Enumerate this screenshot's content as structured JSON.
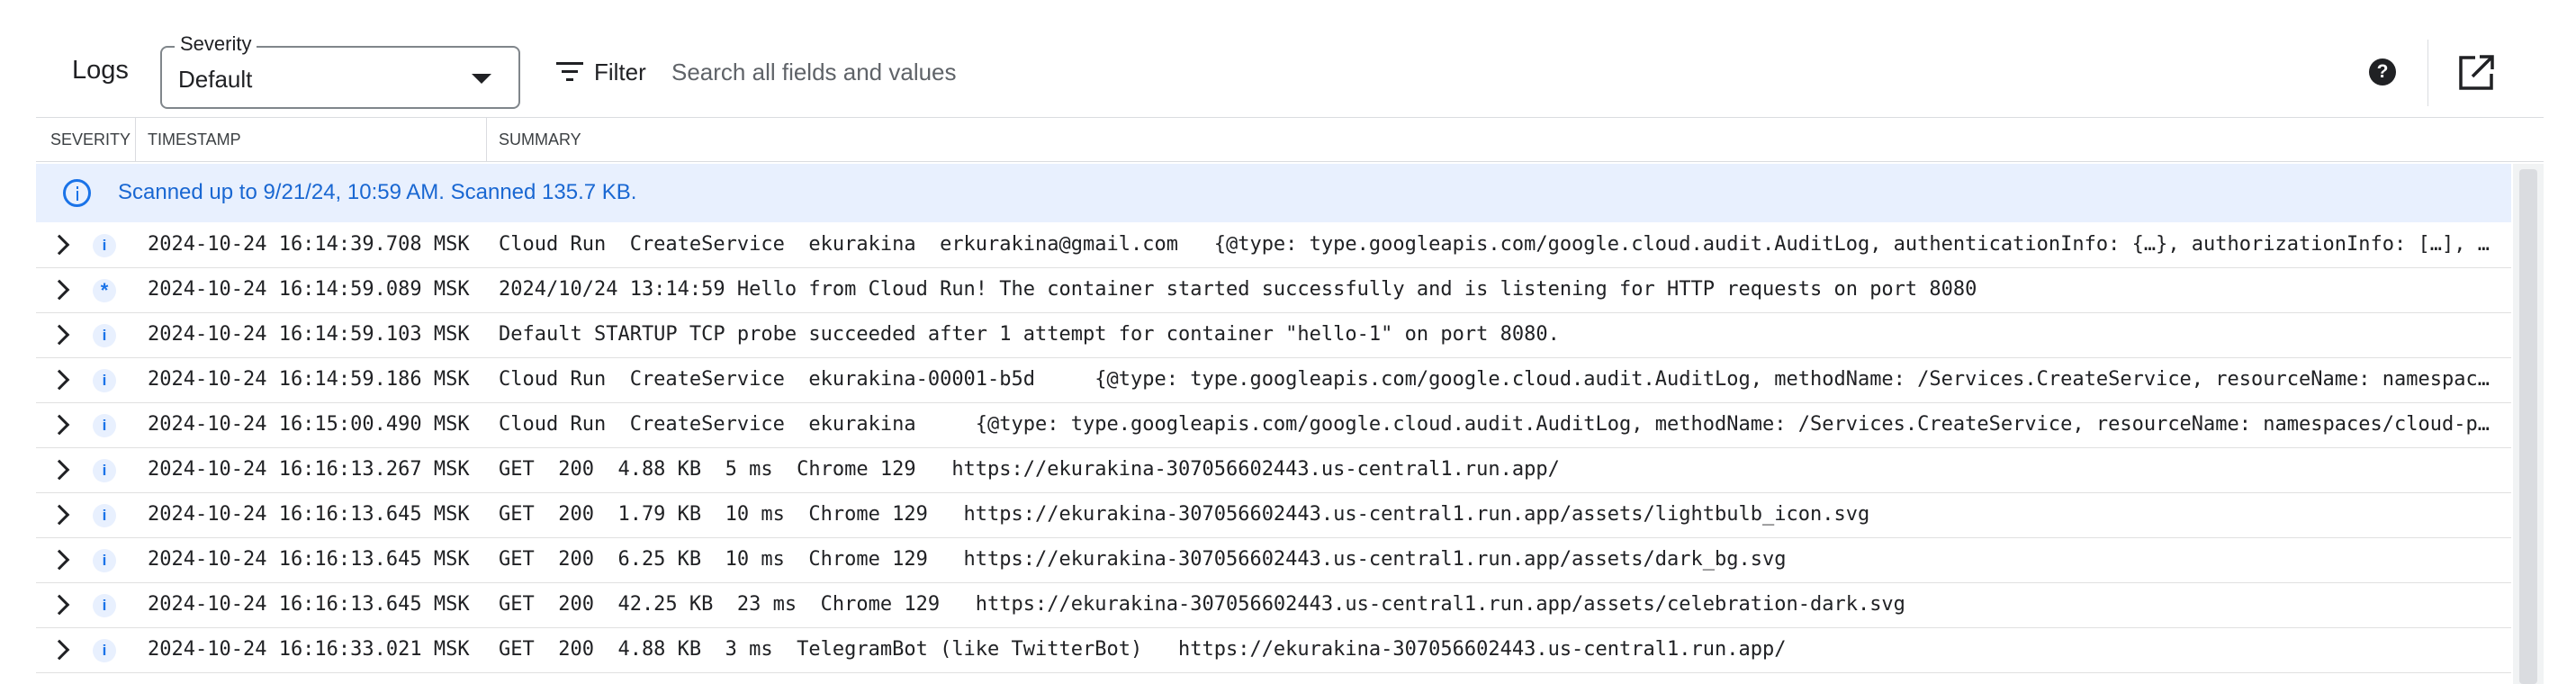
{
  "toolbar": {
    "title": "Logs",
    "severity_label": "Severity",
    "severity_value": "Default",
    "filter_label": "Filter",
    "search_placeholder": "Search all fields and values"
  },
  "table": {
    "columns": [
      "SEVERITY",
      "TIMESTAMP",
      "SUMMARY"
    ]
  },
  "banner": {
    "text": "Scanned up to 9/21/24, 10:59 AM. Scanned 135.7 KB."
  },
  "rows": [
    {
      "severity": "info",
      "timestamp": "2024-10-24 16:14:39.708 MSK",
      "summary": "Cloud Run  CreateService  ekurakina  erkurakina@gmail.com   {@type: type.googleapis.com/google.cloud.audit.AuditLog, authenticationInfo: {…}, authorizationInfo: […], methodName: /Services.CreateService, …}"
    },
    {
      "severity": "default",
      "timestamp": "2024-10-24 16:14:59.089 MSK",
      "summary": "2024/10/24 13:14:59 Hello from Cloud Run! The container started successfully and is listening for HTTP requests on port 8080"
    },
    {
      "severity": "info",
      "timestamp": "2024-10-24 16:14:59.103 MSK",
      "summary": "Default STARTUP TCP probe succeeded after 1 attempt for container \"hello-1\" on port 8080."
    },
    {
      "severity": "info",
      "timestamp": "2024-10-24 16:14:59.186 MSK",
      "summary": "Cloud Run  CreateService  ekurakina-00001-b5d     {@type: type.googleapis.com/google.cloud.audit.AuditLog, methodName: /Services.CreateService, resourceName: namespaces/cloud-platform, …}"
    },
    {
      "severity": "info",
      "timestamp": "2024-10-24 16:15:00.490 MSK",
      "summary": "Cloud Run  CreateService  ekurakina     {@type: type.googleapis.com/google.cloud.audit.AuditLog, methodName: /Services.CreateService, resourceName: namespaces/cloud-platform, …}"
    },
    {
      "severity": "info",
      "timestamp": "2024-10-24 16:16:13.267 MSK",
      "summary": "GET  200  4.88 KB  5 ms  Chrome 129   https://ekurakina-307056602443.us-central1.run.app/"
    },
    {
      "severity": "info",
      "timestamp": "2024-10-24 16:16:13.645 MSK",
      "summary": "GET  200  1.79 KB  10 ms  Chrome 129   https://ekurakina-307056602443.us-central1.run.app/assets/lightbulb_icon.svg"
    },
    {
      "severity": "info",
      "timestamp": "2024-10-24 16:16:13.645 MSK",
      "summary": "GET  200  6.25 KB  10 ms  Chrome 129   https://ekurakina-307056602443.us-central1.run.app/assets/dark_bg.svg"
    },
    {
      "severity": "info",
      "timestamp": "2024-10-24 16:16:13.645 MSK",
      "summary": "GET  200  42.25 KB  23 ms  Chrome 129   https://ekurakina-307056602443.us-central1.run.app/assets/celebration-dark.svg"
    },
    {
      "severity": "info",
      "timestamp": "2024-10-24 16:16:33.021 MSK",
      "summary": "GET  200  4.88 KB  3 ms  TelegramBot (like TwitterBot)   https://ekurakina-307056602443.us-central1.run.app/"
    }
  ],
  "icons": {
    "severity_info": "info-icon",
    "severity_default": "asterisk-icon",
    "help": "help-icon",
    "open_in_new": "open-in-new-icon"
  },
  "colors": {
    "accent": "#1a73e8",
    "banner_bg": "#e8f0fe",
    "banner_text": "#1967d2",
    "border": "#dadce0"
  }
}
